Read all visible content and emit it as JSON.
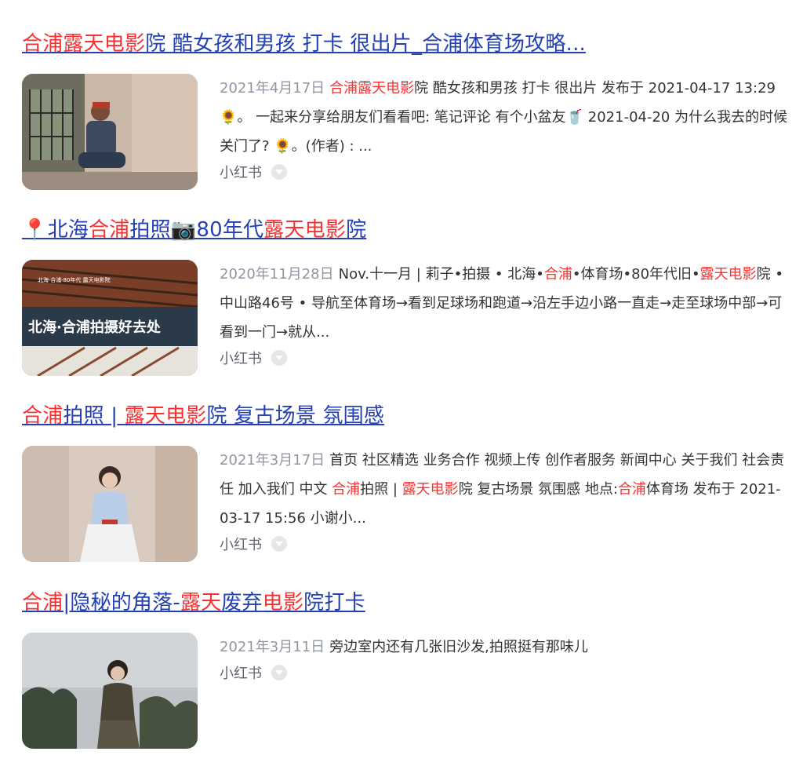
{
  "results": [
    {
      "title_parts": [
        {
          "text": "合浦露天电影",
          "hl": true
        },
        {
          "text": "院 酷女孩和男孩 打卡 很出片_",
          "hl": false
        },
        {
          "text": "合浦",
          "hl": false
        },
        {
          "text": "体育场攻略...",
          "hl": false
        }
      ],
      "date": "2021年4月17日",
      "snippet_parts": [
        {
          "text": "合浦露天电影",
          "hl": true
        },
        {
          "text": "院 酷女孩和男孩 打卡 很出片 发布于 2021-04-17 13:29 🌻。 一起来分享给朋友们看看吧: 笔记评论 有个小盆友🥤 2021-04-20 为什么我去的时候关门了? 🌻。(作者) : ...",
          "hl": false
        }
      ],
      "source": "小红书",
      "thumb": "girl-in-window"
    },
    {
      "title_parts": [
        {
          "text": "📍北海",
          "hl": false
        },
        {
          "text": "合浦",
          "hl": true
        },
        {
          "text": "拍照📷80年代",
          "hl": false
        },
        {
          "text": "露天电影",
          "hl": true
        },
        {
          "text": "院",
          "hl": false
        }
      ],
      "date": "2020年11月28日",
      "snippet_parts": [
        {
          "text": "Nov.十一月 | 莉子•拍摄 • 北海•",
          "hl": false
        },
        {
          "text": "合浦",
          "hl": true
        },
        {
          "text": "•体育场•80年代旧•",
          "hl": false
        },
        {
          "text": "露天电影",
          "hl": true
        },
        {
          "text": "院 • 中山路46号 • 导航至体育场→看到足球场和跑道→沿左手边小路一直走→走至球场中部→可看到一门→就从...",
          "hl": false
        }
      ],
      "source": "小红书",
      "thumb": "beihai-hepu",
      "thumb_text_main": "北海·合浦拍摄好去处",
      "thumb_text_small": "北海·合浦·80年代 露天电影院"
    },
    {
      "title_parts": [
        {
          "text": "合浦",
          "hl": true
        },
        {
          "text": "拍照 | ",
          "hl": false
        },
        {
          "text": "露天电影",
          "hl": true
        },
        {
          "text": "院 复古场景 氛围感",
          "hl": false
        }
      ],
      "date": "2021年3月17日",
      "snippet_parts": [
        {
          "text": "首页 社区精选 业务合作 视频上传 创作者服务 新闻中心 关于我们 社会责任 加入我们 中文 ",
          "hl": false
        },
        {
          "text": "合浦",
          "hl": true
        },
        {
          "text": "拍照 | ",
          "hl": false
        },
        {
          "text": "露天电影",
          "hl": true
        },
        {
          "text": "院 复古场景 氛围感 地点:",
          "hl": false
        },
        {
          "text": "合浦",
          "hl": true
        },
        {
          "text": "体育场 发布于 2021-03-17 15:56 小谢小...",
          "hl": false
        }
      ],
      "source": "小红书",
      "thumb": "girl-blue-top"
    },
    {
      "title_parts": [
        {
          "text": "合浦",
          "hl": true
        },
        {
          "text": "|隐秘的角落-",
          "hl": false
        },
        {
          "text": "露天",
          "hl": true
        },
        {
          "text": "废弃",
          "hl": false
        },
        {
          "text": "电影",
          "hl": true
        },
        {
          "text": "院打卡",
          "hl": false
        }
      ],
      "date": "2021年3月11日",
      "snippet_parts": [
        {
          "text": "旁边室内还有几张旧沙发,拍照挺有那味儿",
          "hl": false
        }
      ],
      "source": "小红书",
      "thumb": "girl-trees"
    }
  ],
  "colors": {
    "title": "#2440b3",
    "highlight": "#f73131",
    "date": "#9195a3",
    "text": "#333333",
    "source": "#626675"
  }
}
